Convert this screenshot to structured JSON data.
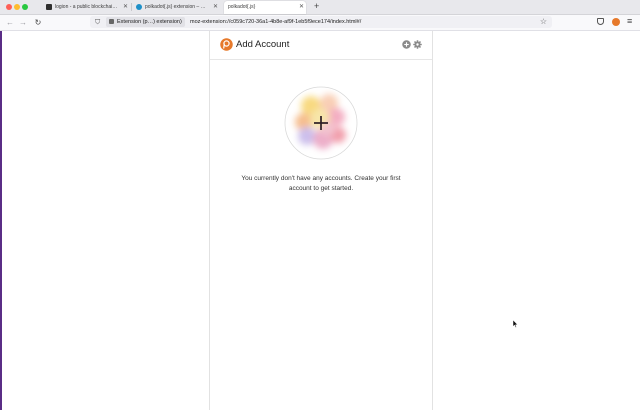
{
  "browser": {
    "tabs": [
      {
        "label": "logion - a public blockchain syst…",
        "active": false
      },
      {
        "label": "polkadot{.js} extension – Get th…",
        "active": false
      },
      {
        "label": "polkadot{.js}",
        "active": true
      }
    ],
    "new_tab_symbol": "+",
    "url_identity_label": "Extension (p…) extension)",
    "url": "moz-extension://c059c720-36a1-4b8e-af9f-1eb5f9ece174/index.html#/"
  },
  "panel": {
    "header_title": "Add Account",
    "empty_message": "You currently don't have any accounts. Create your first account to get started.",
    "identicon_symbol": "+"
  },
  "colors": {
    "brand_orange": "#e6792b",
    "traffic_red": "#fe5f57",
    "traffic_yellow": "#febc2e",
    "traffic_green": "#28c840"
  },
  "icons": {
    "header_add": "plus-circle-icon",
    "header_settings": "gear-icon",
    "logo": "polkadot-logo-icon"
  }
}
